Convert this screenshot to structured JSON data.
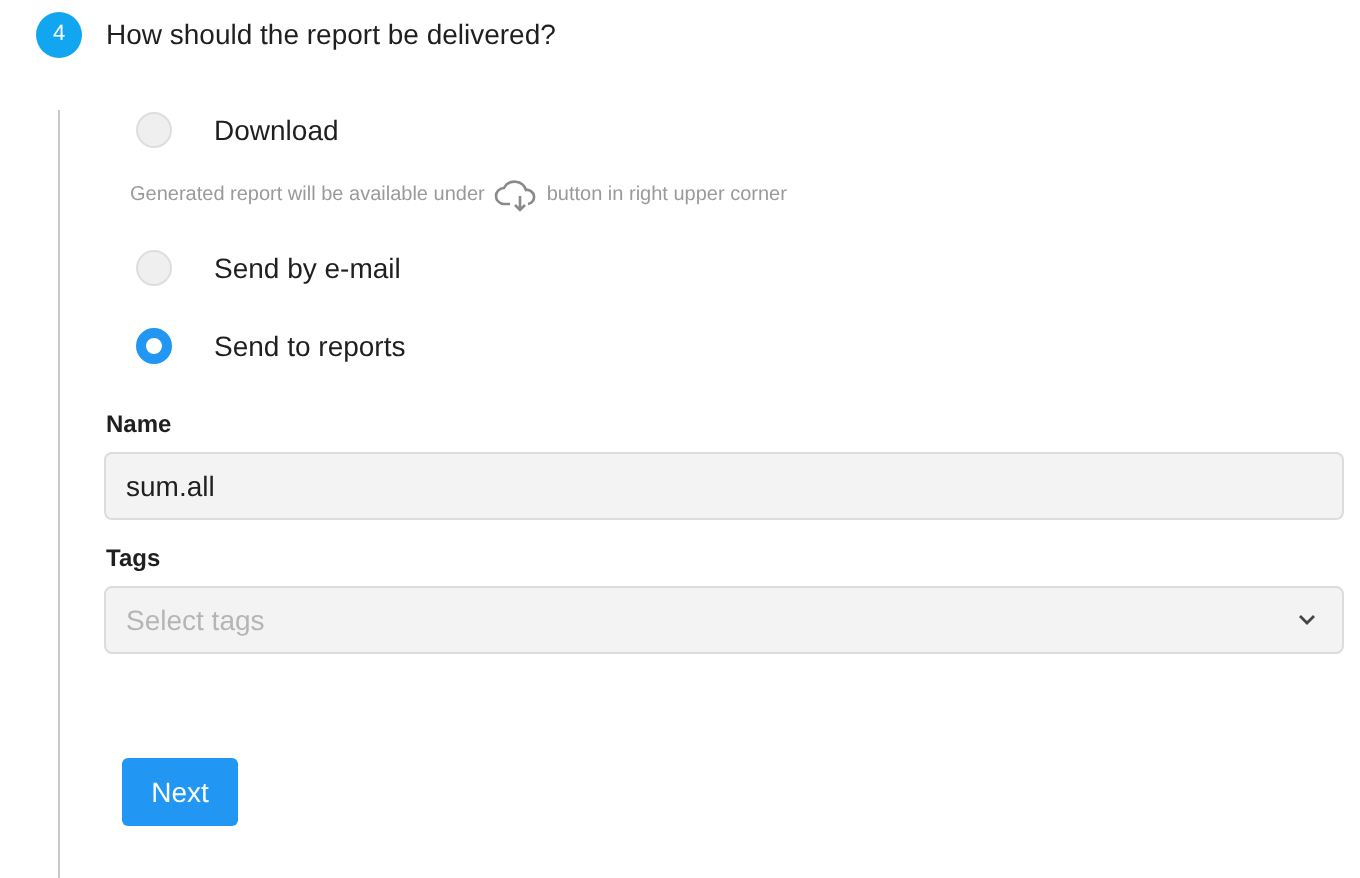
{
  "step": {
    "number": "4",
    "title": "How should the report be delivered?"
  },
  "options": [
    {
      "label": "Download",
      "selected": false,
      "hint_before": "Generated report will be available under",
      "hint_after": "button in right upper corner"
    },
    {
      "label": "Send by e-mail",
      "selected": false
    },
    {
      "label": "Send to reports",
      "selected": true
    }
  ],
  "name_field": {
    "label": "Name",
    "value": "sum.all"
  },
  "tags_field": {
    "label": "Tags",
    "placeholder": "Select tags"
  },
  "buttons": [
    "Next"
  ]
}
